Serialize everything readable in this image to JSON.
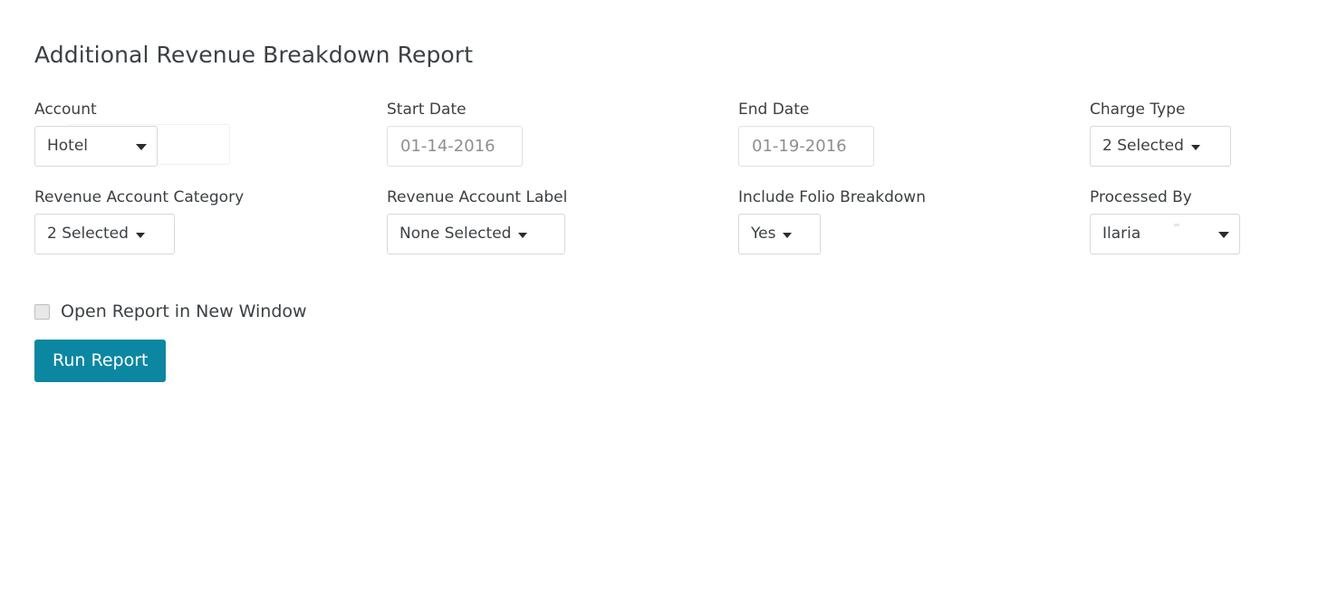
{
  "page": {
    "title": "Additional Revenue Breakdown Report",
    "accent_color": "#0c87a1",
    "text_color": "#3c4043",
    "border_color": "#d8d8d8",
    "placeholder_color": "#8f8f8f"
  },
  "filters": {
    "row1": [
      {
        "label": "Account",
        "control": "native-select",
        "value": "Hotel",
        "icon": "chevron-down-icon"
      },
      {
        "label": "Start Date",
        "control": "date-input",
        "value": "01-14-2016",
        "placeholder": "01-14-2016"
      },
      {
        "label": "End Date",
        "control": "date-input",
        "value": "01-19-2016",
        "placeholder": "01-19-2016"
      },
      {
        "label": "Charge Type",
        "control": "dropdown",
        "value": "2 Selected",
        "icon": "caret-down-icon"
      }
    ],
    "row2": [
      {
        "label": "Revenue Account Category",
        "control": "dropdown",
        "value": "2 Selected",
        "icon": "caret-down-icon"
      },
      {
        "label": "Revenue Account Label",
        "control": "dropdown",
        "value": "None Selected",
        "icon": "caret-down-icon"
      },
      {
        "label": "Include Folio Breakdown",
        "control": "dropdown",
        "value": "Yes",
        "icon": "caret-down-icon"
      },
      {
        "label": "Processed By",
        "control": "native-select",
        "value": "Ilaria",
        "icon": "chevron-down-icon"
      }
    ]
  },
  "options": {
    "open_in_new_window": {
      "label": "Open Report in New Window",
      "checked": false
    }
  },
  "actions": {
    "run_report": "Run Report"
  }
}
